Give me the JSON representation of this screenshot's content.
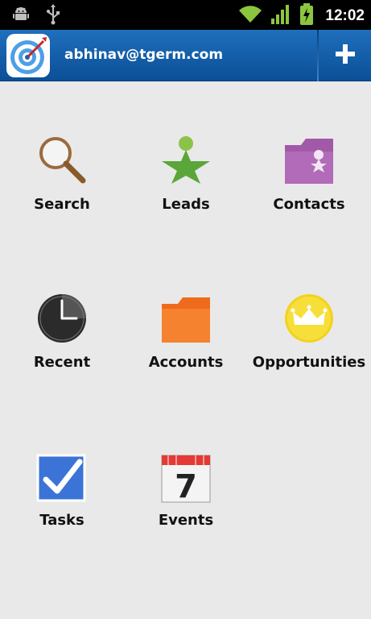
{
  "status_bar": {
    "time": "12:02",
    "icons": [
      "android-debug-icon",
      "usb-icon",
      "wifi-icon",
      "signal-icon",
      "battery-charging-icon"
    ],
    "accent": "#8cc63f"
  },
  "header": {
    "account_email": "abhinav@tgerm.com",
    "logo_icon": "target-dart-icon",
    "add_icon": "plus-icon",
    "bg_color": "#1565b4"
  },
  "menu": {
    "items": [
      {
        "label": "Search",
        "icon": "magnifier-icon"
      },
      {
        "label": "Leads",
        "icon": "person-star-icon"
      },
      {
        "label": "Contacts",
        "icon": "contact-folder-icon"
      },
      {
        "label": "Recent",
        "icon": "clock-icon"
      },
      {
        "label": "Accounts",
        "icon": "folder-icon"
      },
      {
        "label": "Opportunities",
        "icon": "crown-icon"
      },
      {
        "label": "Tasks",
        "icon": "checkbox-icon"
      },
      {
        "label": "Events",
        "icon": "calendar-icon"
      }
    ],
    "calendar_day": "7"
  }
}
